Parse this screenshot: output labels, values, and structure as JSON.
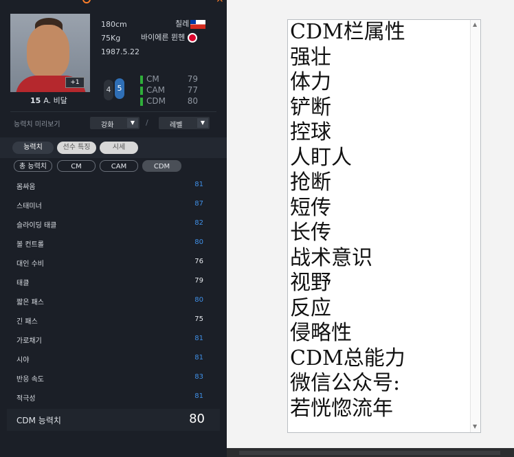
{
  "player": {
    "name": "A. 비달",
    "number": "15",
    "height": "180cm",
    "weight": "75Kg",
    "birth": "1987.5.22",
    "nation": "칠레",
    "club": "바이에른 뮌헨",
    "badge": "+1",
    "weak_foot": "4",
    "strong_foot": "5"
  },
  "positions": [
    {
      "label": "CM",
      "value": "79"
    },
    {
      "label": "CAM",
      "value": "77"
    },
    {
      "label": "CDM",
      "value": "80"
    }
  ],
  "controls": {
    "preview_label": "능력치 미리보기",
    "enhance": "강화",
    "level": "레벨",
    "separator": "/"
  },
  "tabs": [
    "능력치",
    "선수 특징",
    "시세"
  ],
  "filters": [
    "총 능력치",
    "CM",
    "CAM",
    "CDM"
  ],
  "stats": [
    {
      "name": "몸싸움",
      "value": "81",
      "color": "#3f8fe6"
    },
    {
      "name": "스태미너",
      "value": "87",
      "color": "#3f8fe6"
    },
    {
      "name": "슬라이딩 태클",
      "value": "82",
      "color": "#3f8fe6"
    },
    {
      "name": "볼 컨트롤",
      "value": "80",
      "color": "#3f8fe6"
    },
    {
      "name": "대인 수비",
      "value": "76",
      "color": "#e8ebef"
    },
    {
      "name": "태클",
      "value": "79",
      "color": "#e8ebef"
    },
    {
      "name": "짧은 패스",
      "value": "80",
      "color": "#3f8fe6"
    },
    {
      "name": "긴 패스",
      "value": "75",
      "color": "#e8ebef"
    },
    {
      "name": "가로채기",
      "value": "81",
      "color": "#3f8fe6"
    },
    {
      "name": "시야",
      "value": "81",
      "color": "#3f8fe6"
    },
    {
      "name": "반응 속도",
      "value": "83",
      "color": "#3f8fe6"
    },
    {
      "name": "적극성",
      "value": "81",
      "color": "#3f8fe6"
    }
  ],
  "total": {
    "label": "CDM 능력치",
    "value": "80"
  },
  "notes": [
    "CDM栏属性",
    "强壮",
    "体力",
    "铲断",
    "控球",
    "人盯人",
    "抢断",
    "短传",
    "长传",
    "战术意识",
    "视野",
    "反应",
    "侵略性",
    "CDM总能力",
    "微信公众号:",
    "若恍惚流年"
  ],
  "colors": {
    "panel": "#1b1f27",
    "accent_blue": "#3f8fe6",
    "position_bar": "#2fae3a"
  }
}
